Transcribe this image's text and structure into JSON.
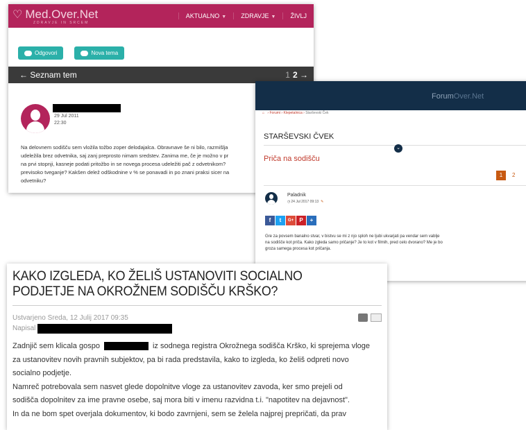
{
  "medovernet": {
    "logo": "Med.Over.Net",
    "tagline": "ZDRAVJE IN SRCEM",
    "nav": [
      "AKTUALNO",
      "ZDRAVJE",
      "ŽIVLJ"
    ],
    "reply_btn": "Odgovori",
    "new_topic_btn": "Nova tema",
    "back_label": "Seznam tem",
    "pages_prev": "1",
    "pages_current": "2",
    "post_date": "29 Jul 2011",
    "post_time": "22:30",
    "post_text": "Na delovnem sodišču sem vložila tožbo zoper delodajalca. Obravnave še ni bilo, razmišlja\nudeležila brez odvetnika, saj zanj preprosto nimam sredstev. Zanima me, če je možno v pr\nna prvi stopnji, kasneje podati pritožbo in se novega procesa udeležiti pač z odvetnikom?\nprevisoko tveganje? Kakšen delež odškodnine v % se ponavadi in po znani praksi sicer na\nodvetniku?"
  },
  "forumovernet": {
    "title_a": "Forum",
    "title_b": "Over.Net",
    "crumbs": [
      "Forumi",
      "Klepetalnica",
      "Starševski Ček"
    ],
    "section": "STARŠEVSKI ČVEK",
    "topic": "Priča na sodišču",
    "page_active": "1",
    "page_other": "2",
    "user": "Paladnik",
    "date": "24 Jul 2017 09:13",
    "share_icons": [
      "f",
      "t",
      "G+",
      "P",
      "+"
    ],
    "post_text": "Gre za povsem banalno stvar, v bistvu se mi z njo sploh ne ljubi ukvarjati pa vendar sem vablje\nna sodišče kot priča. Kako zgleda samo pričanje? Je to kot v filmih, pred celo dvorano? Me je bo\ngroza samega procesa kot pričanja."
  },
  "article": {
    "title": "KAKO IZGLEDA, KO ŽELIŠ USTANOVITI SOCIALNO PODJETJE NA OKROŽNEM SODIŠČU KRŠKO?",
    "meta_created": "Ustvarjeno Sreda, 12 Julij 2017 09:35",
    "meta_author_label": "Napisal",
    "para1_a": "Zadnjič sem klicala gospo",
    "para1_b": "iz sodnega registra Okrožnega sodišča Krško, ki sprejema vloge\nza ustanovitev novih pravnih subjektov, pa bi rada predstavila, kako to izgleda, ko želiš odpreti novo\nsocialno podjetje.",
    "para2": "Namreč potrebovala sem nasvet glede dopolnitve vloge za ustanovitev zavoda, ker smo prejeli od\nsodišča dopolnitev za ime pravne osebe, saj mora biti v imenu razvidna t.i. \"napotitev na dejavnost\".\nIn da ne bom spet overjala dokumentov, ki bodo zavrnjeni, sem se želela najprej prepričati, da prav"
  },
  "colors": {
    "medovernet_brand": "#b3245b",
    "medovernet_button": "#2bb0a9",
    "forum_header": "#132e48",
    "forum_accent": "#c0392b"
  }
}
